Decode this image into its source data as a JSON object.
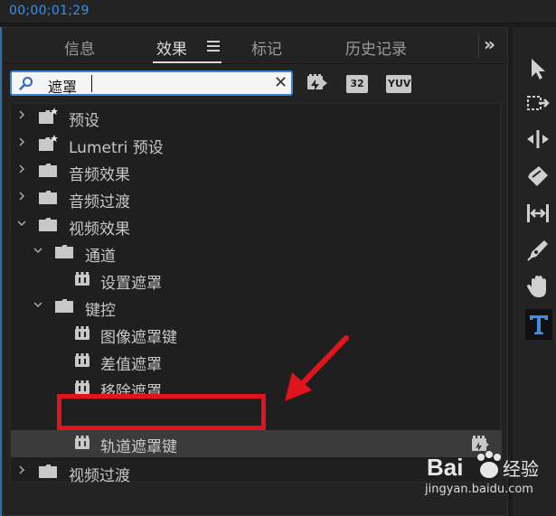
{
  "timecode": "00;00;01;29",
  "tabs": [
    {
      "label": "信息",
      "active": false
    },
    {
      "label": "效果",
      "active": true
    },
    {
      "label": "标记",
      "active": false
    },
    {
      "label": "历史记录",
      "active": false
    }
  ],
  "search": {
    "value": "遮罩"
  },
  "filter_badges": {
    "b32": "32",
    "yuv": "YUV"
  },
  "tree": [
    {
      "label": "预设",
      "kind": "preset-folder",
      "level": 0,
      "expanded": false
    },
    {
      "label": "Lumetri 预设",
      "kind": "preset-folder",
      "level": 0,
      "expanded": false
    },
    {
      "label": "音频效果",
      "kind": "folder",
      "level": 0,
      "expanded": false
    },
    {
      "label": "音频过渡",
      "kind": "folder",
      "level": 0,
      "expanded": false
    },
    {
      "label": "视频效果",
      "kind": "folder",
      "level": 0,
      "expanded": true
    },
    {
      "label": "通道",
      "kind": "folder",
      "level": 1,
      "expanded": true
    },
    {
      "label": "设置遮罩",
      "kind": "effect",
      "level": 2
    },
    {
      "label": "键控",
      "kind": "folder",
      "level": 1,
      "expanded": true
    },
    {
      "label": "图像遮罩键",
      "kind": "effect",
      "level": 2
    },
    {
      "label": "差值遮罩",
      "kind": "effect",
      "level": 2
    },
    {
      "label": "移除遮罩",
      "kind": "effect",
      "level": 2
    },
    {
      "label": "轨道遮罩键",
      "kind": "effect",
      "level": 2,
      "selected": true
    },
    {
      "label": "视频过渡",
      "kind": "folder",
      "level": 0,
      "expanded": false
    }
  ],
  "tools": [
    "selection-tool",
    "track-select-tool",
    "ripple-edit-tool",
    "razor-tool",
    "slip-tool",
    "pen-tool",
    "hand-tool",
    "type-tool"
  ],
  "accent_color": "#3a84d8",
  "annotation_color": "#e0141a",
  "watermark": {
    "brand": "Bai",
    "brand_cn": "经验",
    "site": "jingyan.baidu.com"
  }
}
